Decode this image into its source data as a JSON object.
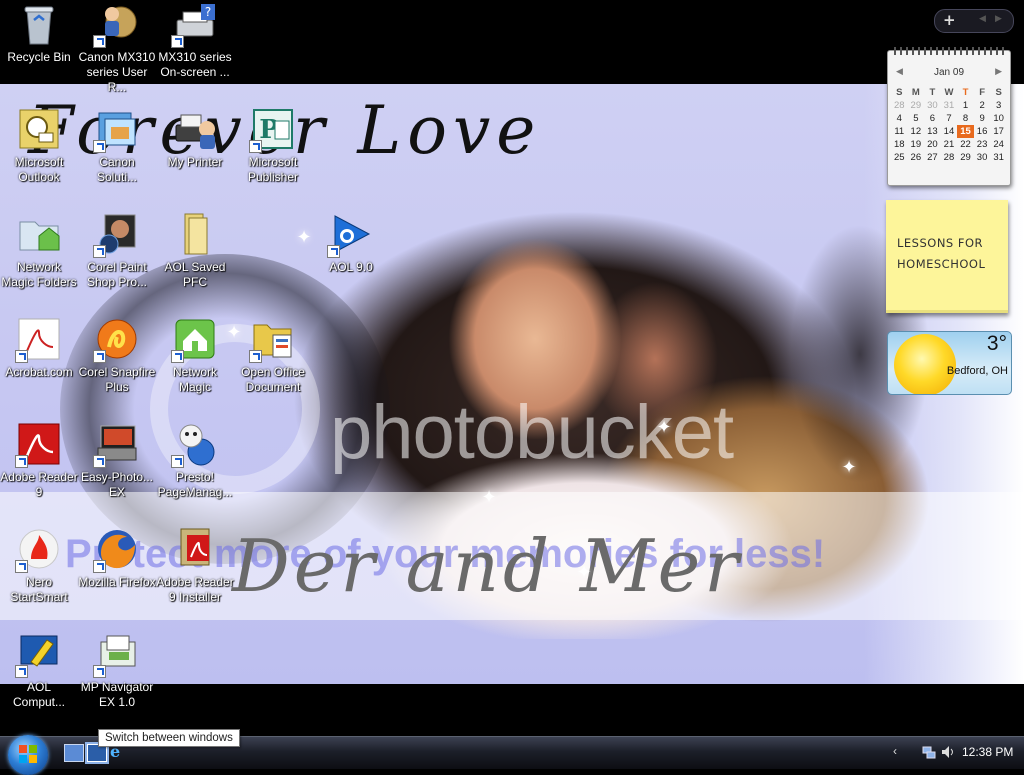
{
  "wallpaper": {
    "title_text": "Forever Love",
    "names_text": "Der and Mer",
    "watermark_text": "photobucket",
    "promo_text": "Protect more of your memories for less!"
  },
  "desktop_icons": [
    {
      "label": "Recycle Bin",
      "icon": "recycle-bin-icon"
    },
    {
      "label": "Canon MX310 series User R...",
      "icon": "user-manual-icon"
    },
    {
      "label": "MX310 series On-screen ...",
      "icon": "printer-help-icon"
    },
    {
      "label": "Microsoft Outlook",
      "icon": "outlook-icon"
    },
    {
      "label": "Canon Soluti...",
      "icon": "canon-solution-icon"
    },
    {
      "label": "My Printer",
      "icon": "printer-icon"
    },
    {
      "label": "Microsoft Publisher",
      "icon": "publisher-icon"
    },
    {
      "label": "Network Magic Folders",
      "icon": "network-folder-icon"
    },
    {
      "label": "Corel Paint Shop Pro...",
      "icon": "paint-shop-icon"
    },
    {
      "label": "AOL Saved PFC",
      "icon": "folder-icon"
    },
    {
      "label": "AOL 9.0",
      "icon": "aol-icon"
    },
    {
      "label": "Acrobat.com",
      "icon": "acrobat-icon"
    },
    {
      "label": "Corel Snapfire Plus",
      "icon": "snapfire-icon"
    },
    {
      "label": "Network Magic",
      "icon": "network-magic-icon"
    },
    {
      "label": "Open Office Document",
      "icon": "open-office-icon"
    },
    {
      "label": "Adobe Reader 9",
      "icon": "adobe-reader-icon"
    },
    {
      "label": "Easy-Photo... EX",
      "icon": "easy-photo-icon"
    },
    {
      "label": "Presto! PageManag...",
      "icon": "presto-icon"
    },
    {
      "label": "Nero StartSmart",
      "icon": "nero-icon"
    },
    {
      "label": "Mozilla Firefox",
      "icon": "firefox-icon"
    },
    {
      "label": "Adobe Reader 9 Installer",
      "icon": "installer-icon"
    },
    {
      "label": "AOL Comput...",
      "icon": "aol-computer-icon"
    },
    {
      "label": "MP Navigator EX 1.0",
      "icon": "mp-navigator-icon"
    }
  ],
  "sidebar": {
    "add_gadget": "+",
    "prev": "◀",
    "next": "▶"
  },
  "calendar": {
    "month": "Jan 09",
    "nav_prev": "◀",
    "nav_next": "▶",
    "weekdays": [
      "S",
      "M",
      "T",
      "W",
      "T",
      "F",
      "S"
    ],
    "weeks": [
      [
        "28",
        "29",
        "30",
        "31",
        "1",
        "2",
        "3"
      ],
      [
        "4",
        "5",
        "6",
        "7",
        "8",
        "9",
        "10"
      ],
      [
        "11",
        "12",
        "13",
        "14",
        "15",
        "16",
        "17"
      ],
      [
        "18",
        "19",
        "20",
        "21",
        "22",
        "23",
        "24"
      ],
      [
        "25",
        "26",
        "27",
        "28",
        "29",
        "30",
        "31"
      ]
    ],
    "today": "15",
    "today_color": "#e86a1e"
  },
  "note": {
    "text": "LESSONS FOR HOMESCHOOL",
    "color": "#fdf59a"
  },
  "weather": {
    "temperature": "3°",
    "location": "Bedford, OH"
  },
  "taskbar": {
    "tooltip": "Switch between windows",
    "clock": "12:38 PM",
    "tray_arrow": "‹"
  }
}
